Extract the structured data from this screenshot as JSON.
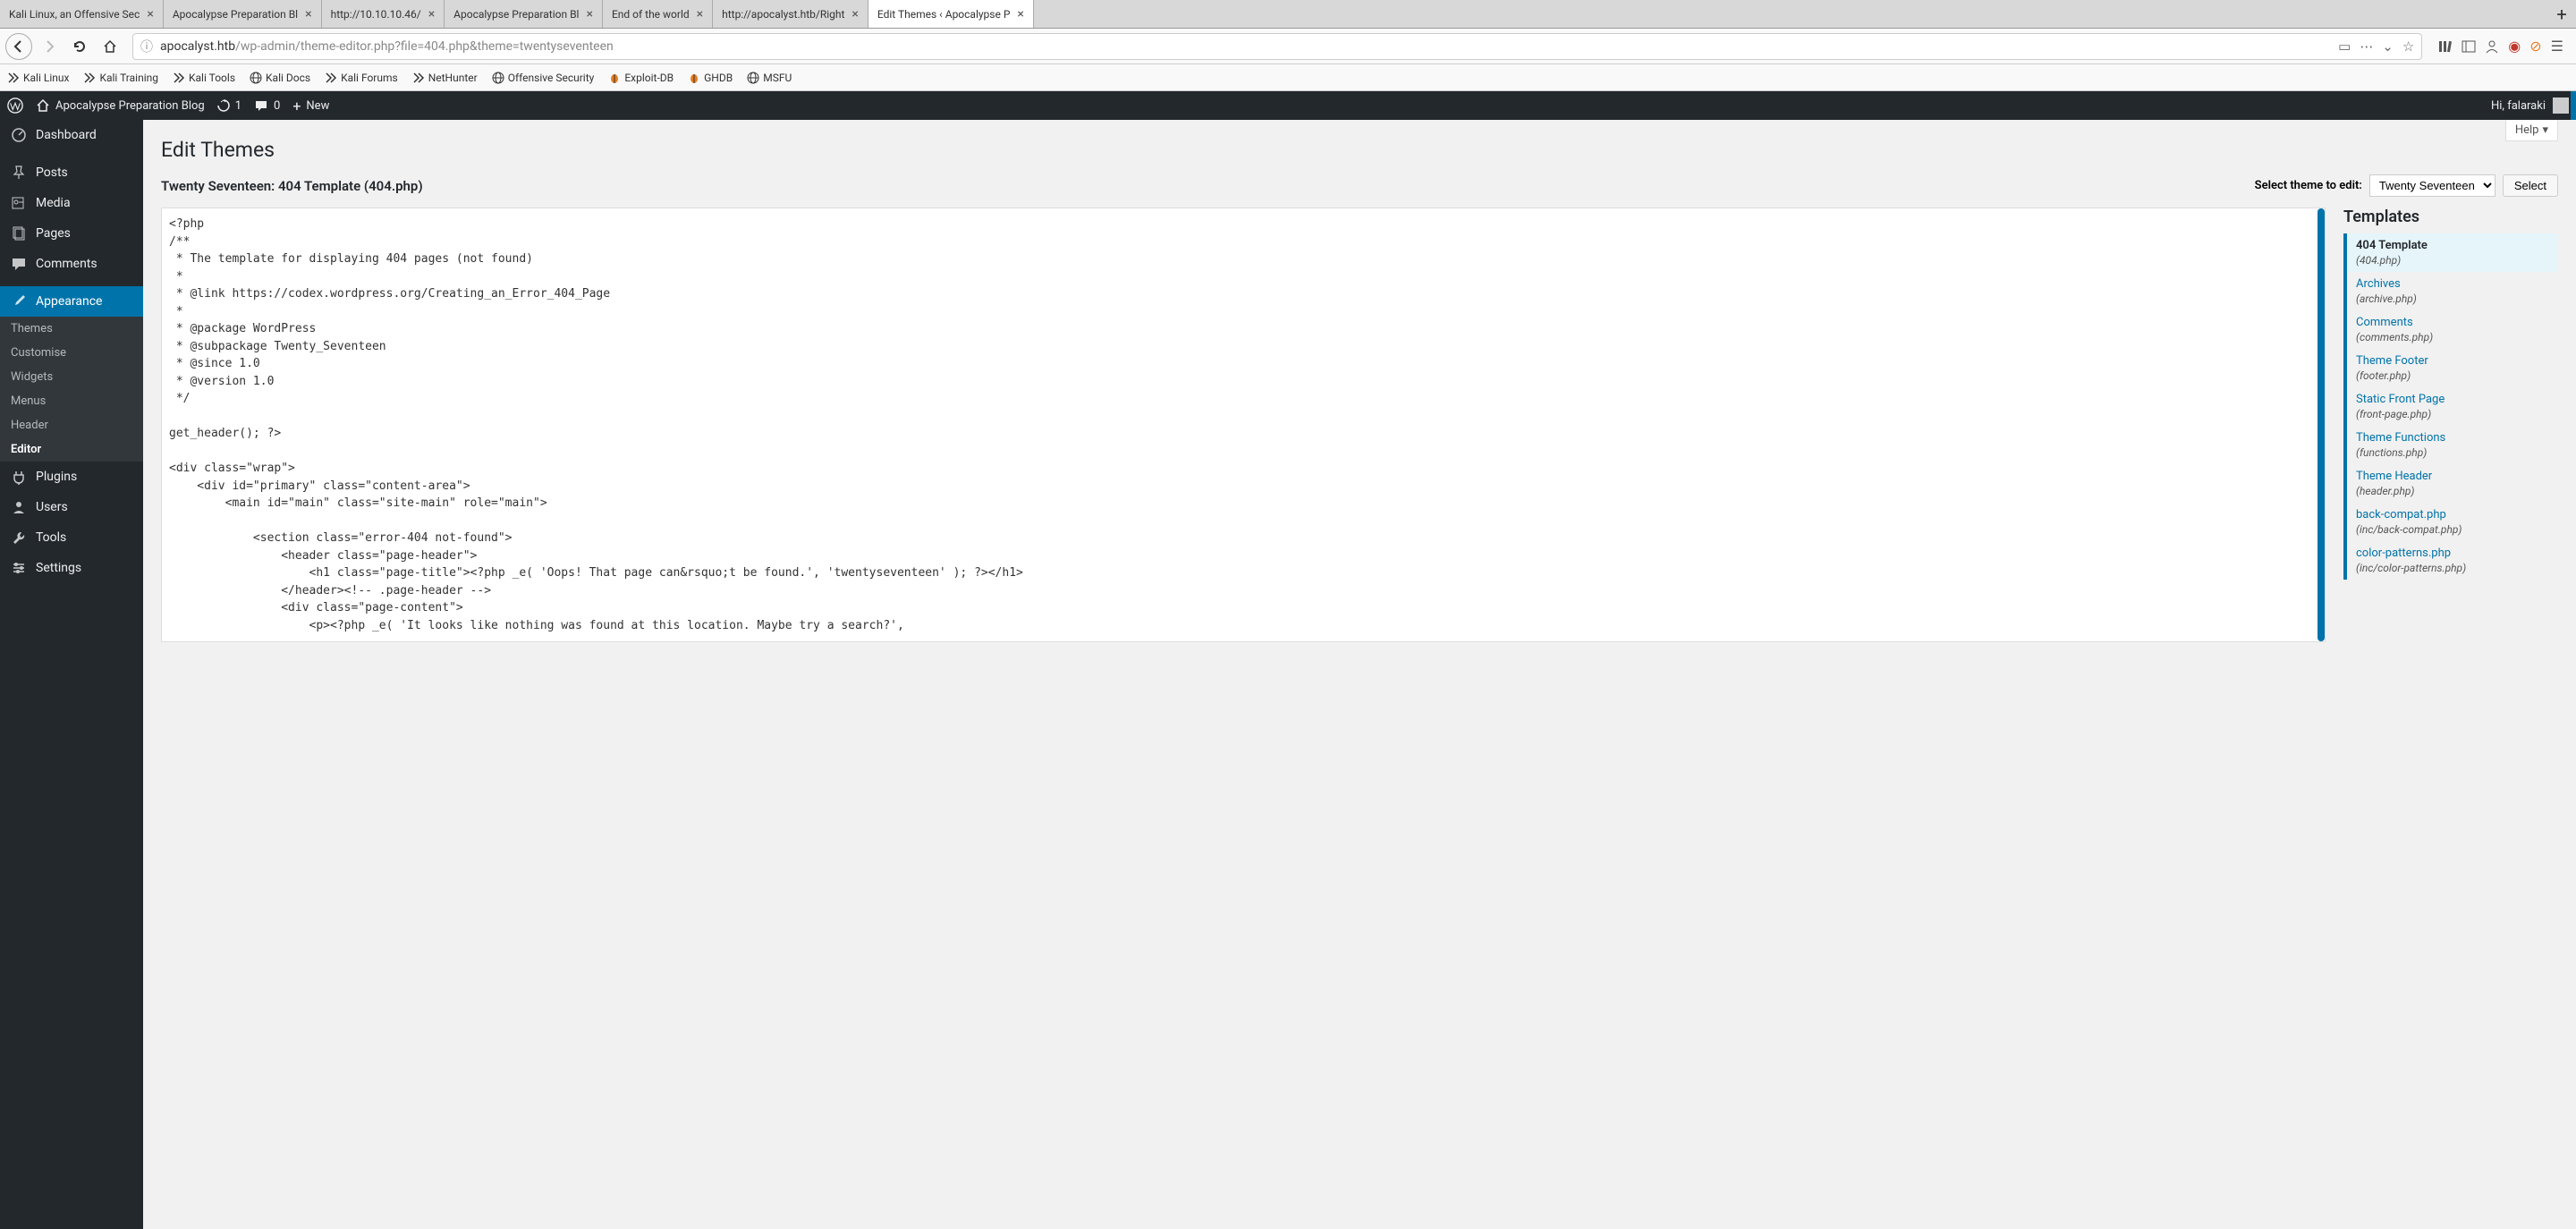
{
  "browser": {
    "tabs": [
      {
        "label": "Kali Linux, an Offensive Sec",
        "active": false
      },
      {
        "label": "Apocalypse Preparation Bl",
        "active": false
      },
      {
        "label": "http://10.10.10.46/",
        "active": false
      },
      {
        "label": "Apocalypse Preparation Bl",
        "active": false
      },
      {
        "label": "End of the world",
        "active": false
      },
      {
        "label": "http://apocalyst.htb/Right",
        "active": false
      },
      {
        "label": "Edit Themes ‹ Apocalypse P",
        "active": true
      }
    ],
    "url_host": "apocalyst.htb",
    "url_path": "/wp-admin/theme-editor.php?file=404.php&theme=twentyseventeen",
    "bookmarks": [
      "Kali Linux",
      "Kali Training",
      "Kali Tools",
      "Kali Docs",
      "Kali Forums",
      "NetHunter",
      "Offensive Security",
      "Exploit-DB",
      "GHDB",
      "MSFU"
    ]
  },
  "wpbar": {
    "site_name": "Apocalypse Preparation Blog",
    "updates": "1",
    "comments": "0",
    "new_label": "New",
    "greeting": "Hi, falaraki"
  },
  "sidebar": {
    "items": [
      {
        "label": "Dashboard",
        "icon": "dashboard"
      },
      {
        "label": "Posts",
        "icon": "pin"
      },
      {
        "label": "Media",
        "icon": "media"
      },
      {
        "label": "Pages",
        "icon": "page"
      },
      {
        "label": "Comments",
        "icon": "comment"
      },
      {
        "label": "Appearance",
        "icon": "brush",
        "current": true
      },
      {
        "label": "Plugins",
        "icon": "plugin"
      },
      {
        "label": "Users",
        "icon": "user"
      },
      {
        "label": "Tools",
        "icon": "wrench"
      },
      {
        "label": "Settings",
        "icon": "settings"
      }
    ],
    "submenu": [
      "Themes",
      "Customise",
      "Widgets",
      "Menus",
      "Header",
      "Editor"
    ],
    "submenu_current": "Editor"
  },
  "content": {
    "help_label": "Help",
    "page_title": "Edit Themes",
    "subheading": "Twenty Seventeen: 404 Template (404.php)",
    "select_label": "Select theme to edit:",
    "select_value": "Twenty Seventeen",
    "select_button": "Select",
    "templates_heading": "Templates",
    "templates": [
      {
        "name": "404 Template",
        "file": "(404.php)",
        "active": true
      },
      {
        "name": "Archives",
        "file": "(archive.php)"
      },
      {
        "name": "Comments",
        "file": "(comments.php)"
      },
      {
        "name": "Theme Footer",
        "file": "(footer.php)"
      },
      {
        "name": "Static Front Page",
        "file": "(front-page.php)"
      },
      {
        "name": "Theme Functions",
        "file": "(functions.php)"
      },
      {
        "name": "Theme Header",
        "file": "(header.php)"
      },
      {
        "name": "back-compat.php",
        "file": "(inc/back-compat.php)"
      },
      {
        "name": "color-patterns.php",
        "file": "(inc/color-patterns.php)"
      }
    ],
    "code": "<?php\n/**\n * The template for displaying 404 pages (not found)\n *\n * @link https://codex.wordpress.org/Creating_an_Error_404_Page\n *\n * @package WordPress\n * @subpackage Twenty_Seventeen\n * @since 1.0\n * @version 1.0\n */\n\nget_header(); ?>\n\n<div class=\"wrap\">\n    <div id=\"primary\" class=\"content-area\">\n        <main id=\"main\" class=\"site-main\" role=\"main\">\n\n            <section class=\"error-404 not-found\">\n                <header class=\"page-header\">\n                    <h1 class=\"page-title\"><?php _e( 'Oops! That page can&rsquo;t be found.', 'twentyseventeen' ); ?></h1>\n                </header><!-- .page-header -->\n                <div class=\"page-content\">\n                    <p><?php _e( 'It looks like nothing was found at this location. Maybe try a search?',"
  }
}
